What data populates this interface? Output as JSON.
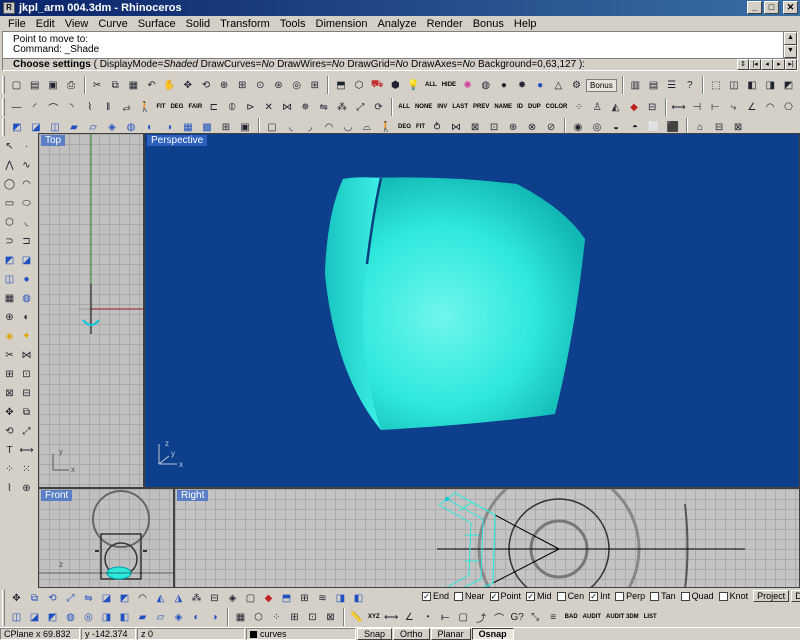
{
  "window": {
    "title": "jkpl_arm 004.3dm - Rhinoceros",
    "btn_min": "_",
    "btn_max": "□",
    "btn_close": "✕"
  },
  "menu": [
    "File",
    "Edit",
    "View",
    "Curve",
    "Surface",
    "Solid",
    "Transform",
    "Tools",
    "Dimension",
    "Analyze",
    "Render",
    "Bonus",
    "Help"
  ],
  "command": {
    "history_line1": "Point to move to:",
    "history_line2": "Command: _Shade",
    "prompt_label": "Choose settings",
    "prompt_open": "(",
    "opt_displaymode": "DisplayMode=",
    "opt_displaymode_val": "Shaded",
    "opt_drawcurves": "DrawCurves=",
    "opt_drawcurves_val": "No",
    "opt_drawwires": "DrawWires=",
    "opt_drawwires_val": "No",
    "opt_drawgrid": "DrawGrid=",
    "opt_drawgrid_val": "No",
    "opt_drawaxes": "DrawAxes=",
    "opt_drawaxes_val": "No",
    "opt_background": "Background=0,63,127",
    "prompt_close": "):"
  },
  "toolbar_text": {
    "all": "ALL",
    "hide": "HIDE",
    "bonus": "Bonus",
    "fit": "FIT",
    "deg": "DEG",
    "fair": "FAIR",
    "none": "NONE",
    "inv": "INV",
    "last": "LAST",
    "prev": "PREV",
    "name": "NAME",
    "id": "ID",
    "dup": "DUP",
    "color": "COLOR",
    "bad": "BAD",
    "audit": "AUDIT",
    "audit3dm": "AUDIT 3DM",
    "list": "LIST",
    "xyz": "XYZ"
  },
  "viewports": {
    "top": "Top",
    "perspective": "Perspective",
    "front": "Front",
    "right": "Right"
  },
  "colors": {
    "perspective_bg": "#0d3f8c",
    "surface": "#2ee8dc",
    "title_active": "#2d5fbf"
  },
  "osnap": {
    "items": [
      {
        "label": "End",
        "checked": true
      },
      {
        "label": "Near",
        "checked": false
      },
      {
        "label": "Point",
        "checked": true
      },
      {
        "label": "Mid",
        "checked": true
      },
      {
        "label": "Cen",
        "checked": false
      },
      {
        "label": "Int",
        "checked": true
      },
      {
        "label": "Perp",
        "checked": false
      },
      {
        "label": "Tan",
        "checked": false
      },
      {
        "label": "Quad",
        "checked": false
      },
      {
        "label": "Knot",
        "checked": false
      }
    ],
    "project": "Project",
    "disable": "Disable"
  },
  "status": {
    "cplane": "CPlane  x 69.832",
    "y": "y -142.374",
    "z": "z 0",
    "layer": "curves",
    "snap": "Snap",
    "ortho": "Ortho",
    "planar": "Planar",
    "osnap": "Osnap"
  }
}
